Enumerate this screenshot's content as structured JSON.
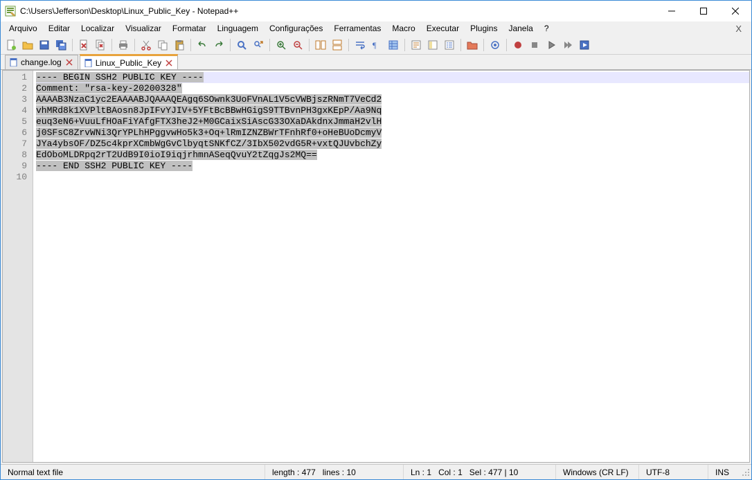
{
  "window": {
    "title": "C:\\Users\\Jefferson\\Desktop\\Linux_Public_Key - Notepad++"
  },
  "menu": {
    "items": [
      "Arquivo",
      "Editar",
      "Localizar",
      "Visualizar",
      "Formatar",
      "Linguagem",
      "Configurações",
      "Ferramentas",
      "Macro",
      "Executar",
      "Plugins",
      "Janela",
      "?"
    ],
    "close_x": "X"
  },
  "toolbar_icons": [
    "new-file-icon",
    "open-file-icon",
    "save-icon",
    "save-all-icon",
    "_sep",
    "close-icon",
    "close-all-icon",
    "_sep",
    "print-icon",
    "_sep",
    "cut-icon",
    "copy-icon",
    "paste-icon",
    "_sep",
    "undo-icon",
    "redo-icon",
    "_sep",
    "find-icon",
    "replace-icon",
    "_sep",
    "zoom-in-icon",
    "zoom-out-icon",
    "_sep",
    "sync-v-icon",
    "sync-h-icon",
    "_sep",
    "wordwrap-icon",
    "all-chars-icon",
    "indent-guide-icon",
    "_sep",
    "lang-udl-icon",
    "doc-map-icon",
    "func-list-icon",
    "_sep",
    "folder-workspace-icon",
    "_sep",
    "monitor-icon",
    "_sep",
    "record-icon",
    "stop-icon",
    "play-icon",
    "play-multi-icon",
    "save-macro-icon"
  ],
  "tabs": [
    {
      "label": "change.log",
      "active": false
    },
    {
      "label": "Linux_Public_Key",
      "active": true
    }
  ],
  "editor": {
    "lines": [
      "---- BEGIN SSH2 PUBLIC KEY ----",
      "Comment: \"rsa-key-20200328\"",
      "AAAAB3NzaC1yc2EAAAABJQAAAQEAgq6SOwnk3UoFVnAL1V5cVWBjszRNmT7VeCd2",
      "vhMRd8k1XVPltBAosn8JpIFvYJIV+5YFtBcBBwHGigS9TTBvnPH3gxKEpP/Aa9Nq",
      "euq3eN6+VuuLfHOaFiYAfgFTX3heJ2+M0GCaixSiAscG33OXaDAkdnxJmmaH2vlH",
      "j0SFsC8ZrvWNi3QrYPLhHPggvwHo5k3+Oq+lRmIZNZBWrTFnhRf0+oHeBUoDcmyV",
      "JYa4ybsOF/DZ5c4kprXCmbWgGvClbyqtSNKfCZ/3IbX502vdG5R+vxtQJUvbchZy",
      "EdOboMLDRpq2rT2UdB9I0ioI9iqjrhmnASeqQvuY2tZqgJs2MQ==",
      "---- END SSH2 PUBLIC KEY ----",
      ""
    ],
    "selected_all": true,
    "current_line_index": 0
  },
  "status": {
    "file_type": "Normal text file",
    "length_label": "length :",
    "length_value": "477",
    "lines_label": "lines :",
    "lines_value": "10",
    "ln_label": "Ln :",
    "ln_value": "1",
    "col_label": "Col :",
    "col_value": "1",
    "sel_label": "Sel :",
    "sel_value": "477 | 10",
    "eol": "Windows (CR LF)",
    "encoding": "UTF-8",
    "ins": "INS"
  },
  "colors": {
    "accent": "#3a8ad6",
    "tab_active_top": "#e8a33d"
  }
}
